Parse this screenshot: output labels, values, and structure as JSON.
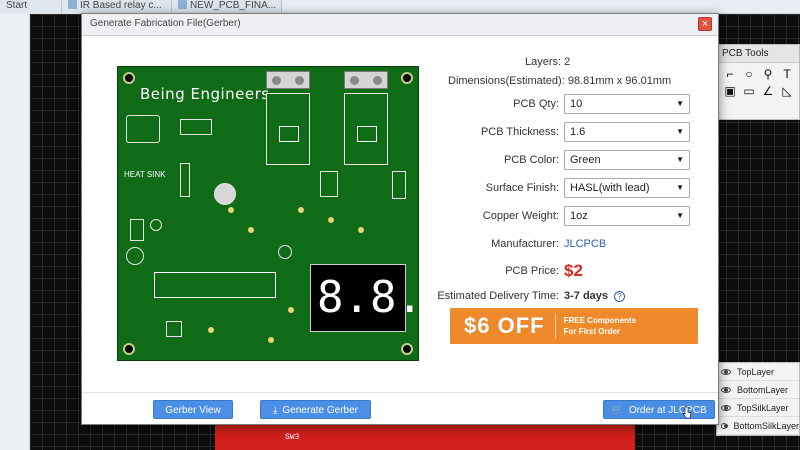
{
  "background": {
    "tabs": [
      {
        "label": "Start"
      },
      {
        "label": "IR Based relay c..."
      },
      {
        "label": "NEW_PCB_FINA..."
      }
    ],
    "pcb_tools_title": "PCB Tools",
    "tool_icons": [
      "pen-icon",
      "circle-icon",
      "pin-icon",
      "text-icon",
      "image-icon",
      "rect-icon",
      "angle-icon",
      "ruler-icon"
    ],
    "layers": [
      "TopLayer",
      "BottomLayer",
      "TopSilkLayer",
      "BottomSilkLayer"
    ],
    "board_label": "SW3"
  },
  "modal": {
    "title": "Generate Fabrication File(Gerber)",
    "close_label": "×"
  },
  "pcb_preview": {
    "title": "Being Engineers",
    "heat_sink": "HEAT SINK",
    "display_digits": "8.8."
  },
  "form": {
    "layers_label": "Layers:",
    "layers_value": "2",
    "dimensions_label": "Dimensions(Estimated):",
    "dimensions_value": "98.81mm x 96.01mm",
    "qty_label": "PCB Qty:",
    "qty_value": "10",
    "thickness_label": "PCB Thickness:",
    "thickness_value": "1.6",
    "color_label": "PCB Color:",
    "color_value": "Green",
    "finish_label": "Surface Finish:",
    "finish_value": "HASL(with lead)",
    "copper_label": "Copper Weight:",
    "copper_value": "1oz",
    "manufacturer_label": "Manufacturer:",
    "manufacturer_value": "JLCPCB",
    "price_label": "PCB Price:",
    "price_value": "$2",
    "delivery_label": "Estimated Delivery Time:",
    "delivery_value": "3-7 days",
    "help": "?"
  },
  "promo": {
    "big": "$6 OFF",
    "line1": "FREE Components",
    "line2": "For First Order"
  },
  "buttons": {
    "gerber_view": "Gerber View",
    "generate_gerber": "Generate Gerber",
    "order": "Order at JLCPCB"
  }
}
